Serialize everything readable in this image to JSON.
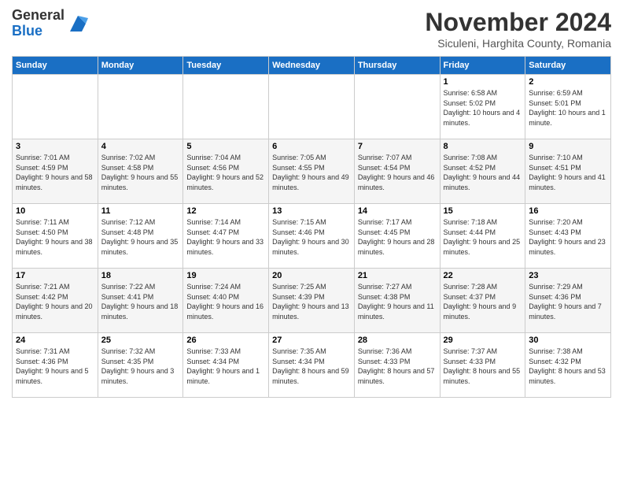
{
  "logo": {
    "line1": "General",
    "line2": "Blue"
  },
  "title": "November 2024",
  "location": "Siculeni, Harghita County, Romania",
  "days_of_week": [
    "Sunday",
    "Monday",
    "Tuesday",
    "Wednesday",
    "Thursday",
    "Friday",
    "Saturday"
  ],
  "weeks": [
    [
      {
        "day": "",
        "info": ""
      },
      {
        "day": "",
        "info": ""
      },
      {
        "day": "",
        "info": ""
      },
      {
        "day": "",
        "info": ""
      },
      {
        "day": "",
        "info": ""
      },
      {
        "day": "1",
        "info": "Sunrise: 6:58 AM\nSunset: 5:02 PM\nDaylight: 10 hours and 4 minutes."
      },
      {
        "day": "2",
        "info": "Sunrise: 6:59 AM\nSunset: 5:01 PM\nDaylight: 10 hours and 1 minute."
      }
    ],
    [
      {
        "day": "3",
        "info": "Sunrise: 7:01 AM\nSunset: 4:59 PM\nDaylight: 9 hours and 58 minutes."
      },
      {
        "day": "4",
        "info": "Sunrise: 7:02 AM\nSunset: 4:58 PM\nDaylight: 9 hours and 55 minutes."
      },
      {
        "day": "5",
        "info": "Sunrise: 7:04 AM\nSunset: 4:56 PM\nDaylight: 9 hours and 52 minutes."
      },
      {
        "day": "6",
        "info": "Sunrise: 7:05 AM\nSunset: 4:55 PM\nDaylight: 9 hours and 49 minutes."
      },
      {
        "day": "7",
        "info": "Sunrise: 7:07 AM\nSunset: 4:54 PM\nDaylight: 9 hours and 46 minutes."
      },
      {
        "day": "8",
        "info": "Sunrise: 7:08 AM\nSunset: 4:52 PM\nDaylight: 9 hours and 44 minutes."
      },
      {
        "day": "9",
        "info": "Sunrise: 7:10 AM\nSunset: 4:51 PM\nDaylight: 9 hours and 41 minutes."
      }
    ],
    [
      {
        "day": "10",
        "info": "Sunrise: 7:11 AM\nSunset: 4:50 PM\nDaylight: 9 hours and 38 minutes."
      },
      {
        "day": "11",
        "info": "Sunrise: 7:12 AM\nSunset: 4:48 PM\nDaylight: 9 hours and 35 minutes."
      },
      {
        "day": "12",
        "info": "Sunrise: 7:14 AM\nSunset: 4:47 PM\nDaylight: 9 hours and 33 minutes."
      },
      {
        "day": "13",
        "info": "Sunrise: 7:15 AM\nSunset: 4:46 PM\nDaylight: 9 hours and 30 minutes."
      },
      {
        "day": "14",
        "info": "Sunrise: 7:17 AM\nSunset: 4:45 PM\nDaylight: 9 hours and 28 minutes."
      },
      {
        "day": "15",
        "info": "Sunrise: 7:18 AM\nSunset: 4:44 PM\nDaylight: 9 hours and 25 minutes."
      },
      {
        "day": "16",
        "info": "Sunrise: 7:20 AM\nSunset: 4:43 PM\nDaylight: 9 hours and 23 minutes."
      }
    ],
    [
      {
        "day": "17",
        "info": "Sunrise: 7:21 AM\nSunset: 4:42 PM\nDaylight: 9 hours and 20 minutes."
      },
      {
        "day": "18",
        "info": "Sunrise: 7:22 AM\nSunset: 4:41 PM\nDaylight: 9 hours and 18 minutes."
      },
      {
        "day": "19",
        "info": "Sunrise: 7:24 AM\nSunset: 4:40 PM\nDaylight: 9 hours and 16 minutes."
      },
      {
        "day": "20",
        "info": "Sunrise: 7:25 AM\nSunset: 4:39 PM\nDaylight: 9 hours and 13 minutes."
      },
      {
        "day": "21",
        "info": "Sunrise: 7:27 AM\nSunset: 4:38 PM\nDaylight: 9 hours and 11 minutes."
      },
      {
        "day": "22",
        "info": "Sunrise: 7:28 AM\nSunset: 4:37 PM\nDaylight: 9 hours and 9 minutes."
      },
      {
        "day": "23",
        "info": "Sunrise: 7:29 AM\nSunset: 4:36 PM\nDaylight: 9 hours and 7 minutes."
      }
    ],
    [
      {
        "day": "24",
        "info": "Sunrise: 7:31 AM\nSunset: 4:36 PM\nDaylight: 9 hours and 5 minutes."
      },
      {
        "day": "25",
        "info": "Sunrise: 7:32 AM\nSunset: 4:35 PM\nDaylight: 9 hours and 3 minutes."
      },
      {
        "day": "26",
        "info": "Sunrise: 7:33 AM\nSunset: 4:34 PM\nDaylight: 9 hours and 1 minute."
      },
      {
        "day": "27",
        "info": "Sunrise: 7:35 AM\nSunset: 4:34 PM\nDaylight: 8 hours and 59 minutes."
      },
      {
        "day": "28",
        "info": "Sunrise: 7:36 AM\nSunset: 4:33 PM\nDaylight: 8 hours and 57 minutes."
      },
      {
        "day": "29",
        "info": "Sunrise: 7:37 AM\nSunset: 4:33 PM\nDaylight: 8 hours and 55 minutes."
      },
      {
        "day": "30",
        "info": "Sunrise: 7:38 AM\nSunset: 4:32 PM\nDaylight: 8 hours and 53 minutes."
      }
    ]
  ]
}
